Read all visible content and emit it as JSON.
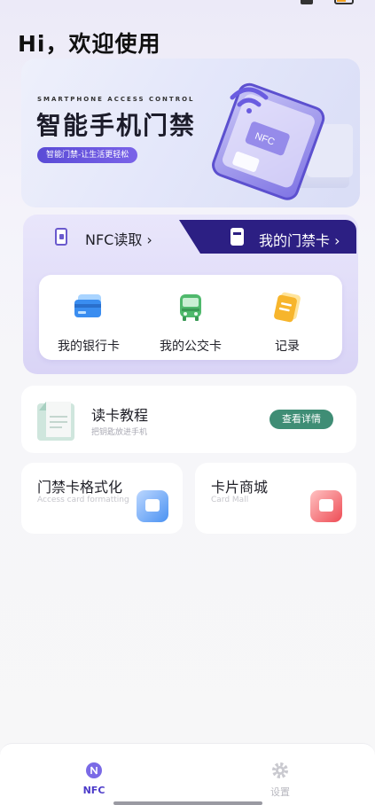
{
  "greeting": "Hi，欢迎使用",
  "banner": {
    "subtitle": "SMARTPHONE ACCESS CONTROL",
    "title": "智能手机门禁",
    "tag": "智能门禁-让生活更轻松",
    "phone_card_text": "NFC"
  },
  "tabs": {
    "nfc_read": "NFC读取 ›",
    "my_cards": "我的门禁卡 ›"
  },
  "quick": [
    {
      "label": "我的银行卡",
      "icon": "bank-card-icon"
    },
    {
      "label": "我的公交卡",
      "icon": "bus-icon"
    },
    {
      "label": "记录",
      "icon": "record-icon"
    }
  ],
  "tutorial": {
    "title": "读卡教程",
    "subtitle": "把钥匙放进手机",
    "button": "查看详情"
  },
  "format_card": {
    "title": "门禁卡格式化",
    "subtitle": "Access card formatting"
  },
  "mall_card": {
    "title": "卡片商城",
    "subtitle": "Card Mall"
  },
  "nav": [
    {
      "label": "NFC",
      "active": true
    },
    {
      "label": "设置",
      "active": false
    }
  ],
  "colors": {
    "accent": "#4b3ac9",
    "tab_dark": "#2c1f83",
    "tutorial_button": "#3f8d75"
  }
}
